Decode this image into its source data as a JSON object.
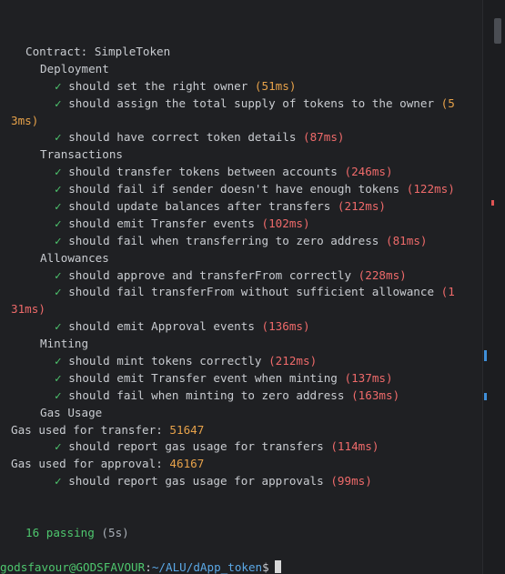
{
  "suite": {
    "title": "Contract: SimpleToken"
  },
  "deployment": {
    "heading": "Deployment",
    "tests": [
      {
        "check": "✓",
        "text": "should set the right owner",
        "time": "(51ms)"
      },
      {
        "check": "✓",
        "text": "should assign the total supply of tokens to the owner",
        "time_part1": "(5",
        "time_part2": "3ms)"
      },
      {
        "check": "✓",
        "text": "should have correct token details",
        "time": "(87ms)"
      }
    ]
  },
  "transactions": {
    "heading": "Transactions",
    "tests": [
      {
        "check": "✓",
        "text": "should transfer tokens between accounts",
        "time": "(246ms)"
      },
      {
        "check": "✓",
        "text": "should fail if sender doesn't have enough tokens",
        "time": "(122ms)"
      },
      {
        "check": "✓",
        "text": "should update balances after transfers",
        "time": "(212ms)"
      },
      {
        "check": "✓",
        "text": "should emit Transfer events",
        "time": "(102ms)"
      },
      {
        "check": "✓",
        "text": "should fail when transferring to zero address",
        "time": "(81ms)"
      }
    ]
  },
  "allowances": {
    "heading": "Allowances",
    "tests": [
      {
        "check": "✓",
        "text": "should approve and transferFrom correctly",
        "time": "(228ms)"
      },
      {
        "check": "✓",
        "text": "should fail transferFrom without sufficient allowance",
        "time_part1": "(1",
        "time_part2": "31ms)"
      },
      {
        "check": "✓",
        "text": "should emit Approval events",
        "time": "(136ms)"
      }
    ]
  },
  "minting": {
    "heading": "Minting",
    "tests": [
      {
        "check": "✓",
        "text": "should mint tokens correctly",
        "time": "(212ms)"
      },
      {
        "check": "✓",
        "text": "should emit Transfer event when minting",
        "time": "(137ms)"
      },
      {
        "check": "✓",
        "text": "should fail when minting to zero address",
        "time": "(163ms)"
      }
    ]
  },
  "gas": {
    "heading": "Gas Usage",
    "transfer_label": "Gas used for transfer:",
    "transfer_value": "51647",
    "transfer_test": {
      "check": "✓",
      "text": "should report gas usage for transfers",
      "time": "(114ms)"
    },
    "approval_label": "Gas used for approval:",
    "approval_value": "46167",
    "approval_test": {
      "check": "✓",
      "text": "should report gas usage for approvals",
      "time": "(99ms)"
    }
  },
  "summary": {
    "passing": "16 passing",
    "duration": "(5s)"
  },
  "prompt": {
    "user": "godsfavour@GODSFAVOUR",
    "sep": ":",
    "path": "~/ALU/dApp_token",
    "symbol": "$"
  },
  "colors": {
    "background": "#1f2023",
    "check_green": "#4ec76e",
    "time_orange": "#e7a24a",
    "time_red": "#ee6a6a",
    "path_blue": "#5ba8e6"
  }
}
